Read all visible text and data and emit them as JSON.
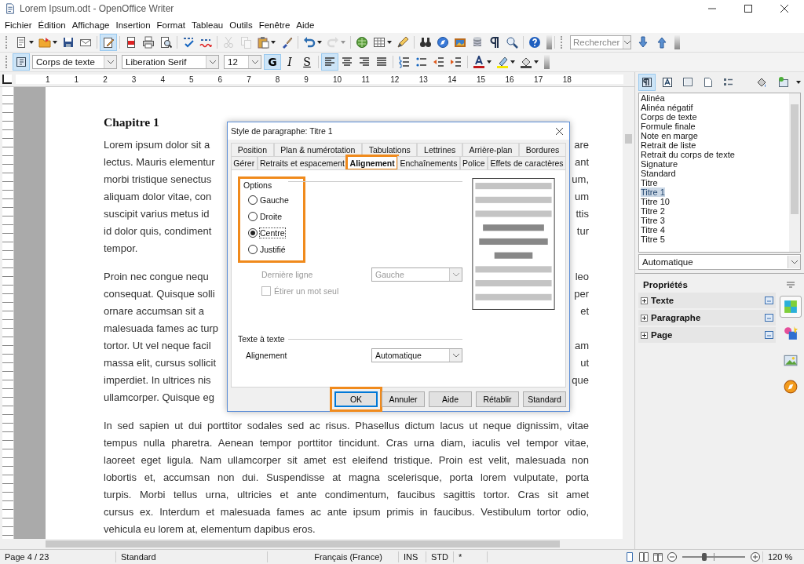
{
  "window": {
    "title": "Lorem Ipsum.odt - OpenOffice Writer"
  },
  "menu": [
    {
      "label": "Fichier"
    },
    {
      "label": "Édition"
    },
    {
      "label": "Affichage"
    },
    {
      "label": "Insertion"
    },
    {
      "label": "Format"
    },
    {
      "label": "Tableau"
    },
    {
      "label": "Outils"
    },
    {
      "label": "Fenêtre"
    },
    {
      "label": "Aide"
    }
  ],
  "standard_toolbar": {
    "items": [
      {
        "kind": "new",
        "caret": true,
        "disabled": false,
        "on": false
      },
      {
        "kind": "open",
        "caret": true,
        "disabled": false,
        "on": false
      },
      {
        "kind": "save",
        "caret": false,
        "disabled": false,
        "on": false
      },
      {
        "kind": "mail",
        "caret": false,
        "disabled": false,
        "on": false
      },
      {
        "kind": "separator"
      },
      {
        "kind": "edit",
        "caret": false,
        "disabled": false,
        "on": true
      },
      {
        "kind": "separator"
      },
      {
        "kind": "pdf",
        "caret": false,
        "disabled": false,
        "on": false
      },
      {
        "kind": "print",
        "caret": false,
        "disabled": false,
        "on": false
      },
      {
        "kind": "preview",
        "caret": false,
        "disabled": false,
        "on": false
      },
      {
        "kind": "separator"
      },
      {
        "kind": "spellcheck",
        "caret": false,
        "disabled": false,
        "on": false
      },
      {
        "kind": "autospell",
        "caret": false,
        "disabled": false,
        "on": false
      },
      {
        "kind": "separator"
      },
      {
        "kind": "cut",
        "caret": false,
        "disabled": true,
        "on": false
      },
      {
        "kind": "copy",
        "caret": false,
        "disabled": true,
        "on": false
      },
      {
        "kind": "paste",
        "caret": true,
        "disabled": false,
        "on": false
      },
      {
        "kind": "brush",
        "caret": false,
        "disabled": false,
        "on": false
      },
      {
        "kind": "separator"
      },
      {
        "kind": "undo",
        "caret": true,
        "disabled": false,
        "on": false
      },
      {
        "kind": "redo",
        "caret": true,
        "disabled": true,
        "on": false
      },
      {
        "kind": "separator"
      },
      {
        "kind": "globe",
        "caret": false,
        "disabled": false,
        "on": false
      },
      {
        "kind": "table",
        "caret": true,
        "disabled": false,
        "on": false
      },
      {
        "kind": "pencil",
        "caret": false,
        "disabled": false,
        "on": false
      },
      {
        "kind": "separator"
      },
      {
        "kind": "binoculars",
        "caret": false,
        "disabled": false,
        "on": false
      },
      {
        "kind": "compass",
        "caret": false,
        "disabled": false,
        "on": false
      },
      {
        "kind": "gallery",
        "caret": false,
        "disabled": false,
        "on": false
      },
      {
        "kind": "database",
        "caret": false,
        "disabled": false,
        "on": false
      },
      {
        "kind": "pilcrow",
        "caret": false,
        "disabled": false,
        "on": false
      },
      {
        "kind": "zoom",
        "caret": false,
        "disabled": false,
        "on": false
      },
      {
        "kind": "separator"
      },
      {
        "kind": "help",
        "caret": false,
        "disabled": false,
        "on": false
      }
    ],
    "search": {
      "placeholder": "Rechercher"
    }
  },
  "format_toolbar": {
    "style": "Corps de texte",
    "font": "Liberation Serif",
    "size": "12",
    "text_buttons": [
      {
        "label": "G",
        "on": true,
        "kind": "bold"
      },
      {
        "label": "I",
        "on": false,
        "kind": "italic"
      },
      {
        "label": "S",
        "on": false,
        "kind": "shadow"
      }
    ],
    "items": [
      {
        "kind": "align-left",
        "caret": false,
        "disabled": false,
        "on": true
      },
      {
        "kind": "align-center",
        "caret": false,
        "disabled": false,
        "on": false
      },
      {
        "kind": "align-right",
        "caret": false,
        "disabled": false,
        "on": false
      },
      {
        "kind": "justify",
        "caret": false,
        "disabled": false,
        "on": false
      },
      {
        "kind": "separator"
      },
      {
        "kind": "numbering",
        "caret": false,
        "disabled": false,
        "on": false
      },
      {
        "kind": "bullets",
        "caret": false,
        "disabled": false,
        "on": false
      },
      {
        "kind": "outdent",
        "caret": false,
        "disabled": false,
        "on": false
      },
      {
        "kind": "indent",
        "caret": false,
        "disabled": false,
        "on": false
      },
      {
        "kind": "separator"
      },
      {
        "kind": "font-color",
        "caret": true,
        "disabled": false,
        "on": false
      },
      {
        "kind": "highlight",
        "caret": true,
        "disabled": false,
        "on": false
      },
      {
        "kind": "background",
        "caret": true,
        "disabled": false,
        "on": false
      }
    ]
  },
  "ruler": {
    "labels": [
      "1",
      "1",
      "2",
      "3",
      "4",
      "5",
      "6",
      "7",
      "8",
      "9",
      "10",
      "11",
      "12",
      "13",
      "14",
      "15",
      "16",
      "17",
      "18"
    ]
  },
  "document": {
    "heading": "Chapitre 1",
    "paragraphs": [
      {
        "lines": [
          {
            "left": "Lorem ipsum dolor sit a",
            "right": "are"
          },
          {
            "left": "lectus. Mauris elementur",
            "right": "ant"
          },
          {
            "left": "morbi tristique senectus",
            "right": "um,"
          },
          {
            "left": "aliquam dolor vitae, con",
            "right": "um"
          },
          {
            "left": "suscipit varius metus id",
            "right": "ttis"
          },
          {
            "left": "id dolor quis, condiment",
            "right": "tur"
          },
          {
            "left": "tempor."
          }
        ]
      },
      {
        "lines": [
          {
            "left": "Proin nec congue nequ",
            "right": "leo"
          },
          {
            "left": "consequat. Quisque solli",
            "right": "per"
          },
          {
            "left": "ornare accumsan sit a",
            "right": "et"
          },
          {
            "left": "malesuada fames ac turp"
          },
          {
            "left": "tortor. Ut vel neque facil",
            "right": "am"
          },
          {
            "left": "massa elit, cursus sollicit",
            "right": "ut"
          },
          {
            "left": "imperdiet. In ultrices nis",
            "right": "que"
          },
          {
            "left": "ullamcorper. Quisque eg"
          }
        ]
      },
      {
        "lines": [
          {
            "full": "In sed sapien ut dui porttitor sodales sed ac risus. Phasellus dictum lacus ut neque dignissim, vitae"
          },
          {
            "full": "tempus nulla pharetra. Aenean tempor porttitor tincidunt. Cras urna diam, iaculis vel tempor vitae,"
          },
          {
            "full": "laoreet eget ligula. Nam ullamcorper sit amet est eleifend tristique. Proin est velit, malesuada non"
          },
          {
            "full": "lobortis et, accumsan non dui. Suspendisse at magna scelerisque, porta lorem vulputate, porta"
          },
          {
            "full": "turpis. Morbi tellus urna, ultricies et ante condimentum, faucibus sagittis tortor. Cras sit amet"
          },
          {
            "full": "cursus ex. Interdum et malesuada fames ac ante ipsum primis in faucibus. Vestibulum tortor odio,"
          },
          {
            "last": "vehicula eu lorem at, elementum dapibus eros."
          }
        ]
      }
    ]
  },
  "dialog": {
    "title": "Style de paragraphe: Titre 1",
    "tabs_row_1": [
      {
        "label": "Position",
        "selected": false
      },
      {
        "label": "Plan & numérotation",
        "selected": false
      },
      {
        "label": "Tabulations",
        "selected": false
      },
      {
        "label": "Lettrines",
        "selected": false
      },
      {
        "label": "Arrière-plan",
        "selected": false
      },
      {
        "label": "Bordures",
        "selected": false
      }
    ],
    "tabs_row_2": [
      {
        "label": "Gérer",
        "selected": false,
        "highlighted": false
      },
      {
        "label": "Retraits et espacement",
        "selected": false,
        "highlighted": false
      },
      {
        "label": "Alignement",
        "selected": true,
        "highlighted": true
      },
      {
        "label": "Enchaînements",
        "selected": false,
        "highlighted": false
      },
      {
        "label": "Police",
        "selected": false,
        "highlighted": false
      },
      {
        "label": "Effets de caractères",
        "selected": false,
        "highlighted": false
      }
    ],
    "options": {
      "label": "Options",
      "highlighted": true,
      "radios": [
        {
          "label": "Gauche",
          "selected": false
        },
        {
          "label": "Droite",
          "selected": false
        },
        {
          "label": "Centre",
          "selected": true
        },
        {
          "label": "Justifié",
          "selected": false
        }
      ]
    },
    "last_line": {
      "label": "Dernière ligne",
      "value": "Gauche",
      "disabled": true
    },
    "stretch": {
      "label": "Étirer un mot seul",
      "checked": false,
      "disabled": true
    },
    "text_to_text": {
      "label": "Texte à texte",
      "field_label": "Alignement",
      "value": "Automatique"
    },
    "buttons": [
      {
        "label": "OK",
        "highlighted": true
      },
      {
        "label": "Annuler",
        "highlighted": false
      },
      {
        "label": "Aide",
        "highlighted": false
      },
      {
        "label": "Rétablir",
        "highlighted": false
      },
      {
        "label": "Standard",
        "highlighted": false
      }
    ]
  },
  "sidebar": {
    "style_types": [
      {
        "kind": "paragraph",
        "selected": true
      },
      {
        "kind": "character",
        "selected": false
      },
      {
        "kind": "frame",
        "selected": false
      },
      {
        "kind": "page",
        "selected": false
      },
      {
        "kind": "list",
        "selected": false
      }
    ],
    "styles": [
      {
        "label": "Alinéa",
        "selected": false
      },
      {
        "label": "Alinéa négatif",
        "selected": false
      },
      {
        "label": "Corps de texte",
        "selected": false
      },
      {
        "label": "Formule finale",
        "selected": false
      },
      {
        "label": "Note en marge",
        "selected": false
      },
      {
        "label": "Retrait de liste",
        "selected": false
      },
      {
        "label": "Retrait du corps de texte",
        "selected": false
      },
      {
        "label": "Signature",
        "selected": false
      },
      {
        "label": "Standard",
        "selected": false
      },
      {
        "label": "Titre",
        "selected": false
      },
      {
        "label": "Titre 1",
        "selected": true
      },
      {
        "label": "Titre 10",
        "selected": false
      },
      {
        "label": "Titre 2",
        "selected": false
      },
      {
        "label": "Titre 3",
        "selected": false
      },
      {
        "label": "Titre 4",
        "selected": false
      },
      {
        "label": "Titre 5",
        "selected": false
      }
    ],
    "filter": "Automatique",
    "properties": {
      "title": "Propriétés",
      "sections": [
        {
          "label": "Texte",
          "expanded": false
        },
        {
          "label": "Paragraphe",
          "expanded": false
        },
        {
          "label": "Page",
          "expanded": false
        }
      ]
    }
  },
  "status_bar": {
    "page": "Page 4 / 23",
    "style": "Standard",
    "language": "Français (France)",
    "insert_mode": "INS",
    "selection_mode": "STD",
    "modified": "*",
    "zoom": {
      "level": 0.35,
      "reading": "120 %"
    }
  }
}
